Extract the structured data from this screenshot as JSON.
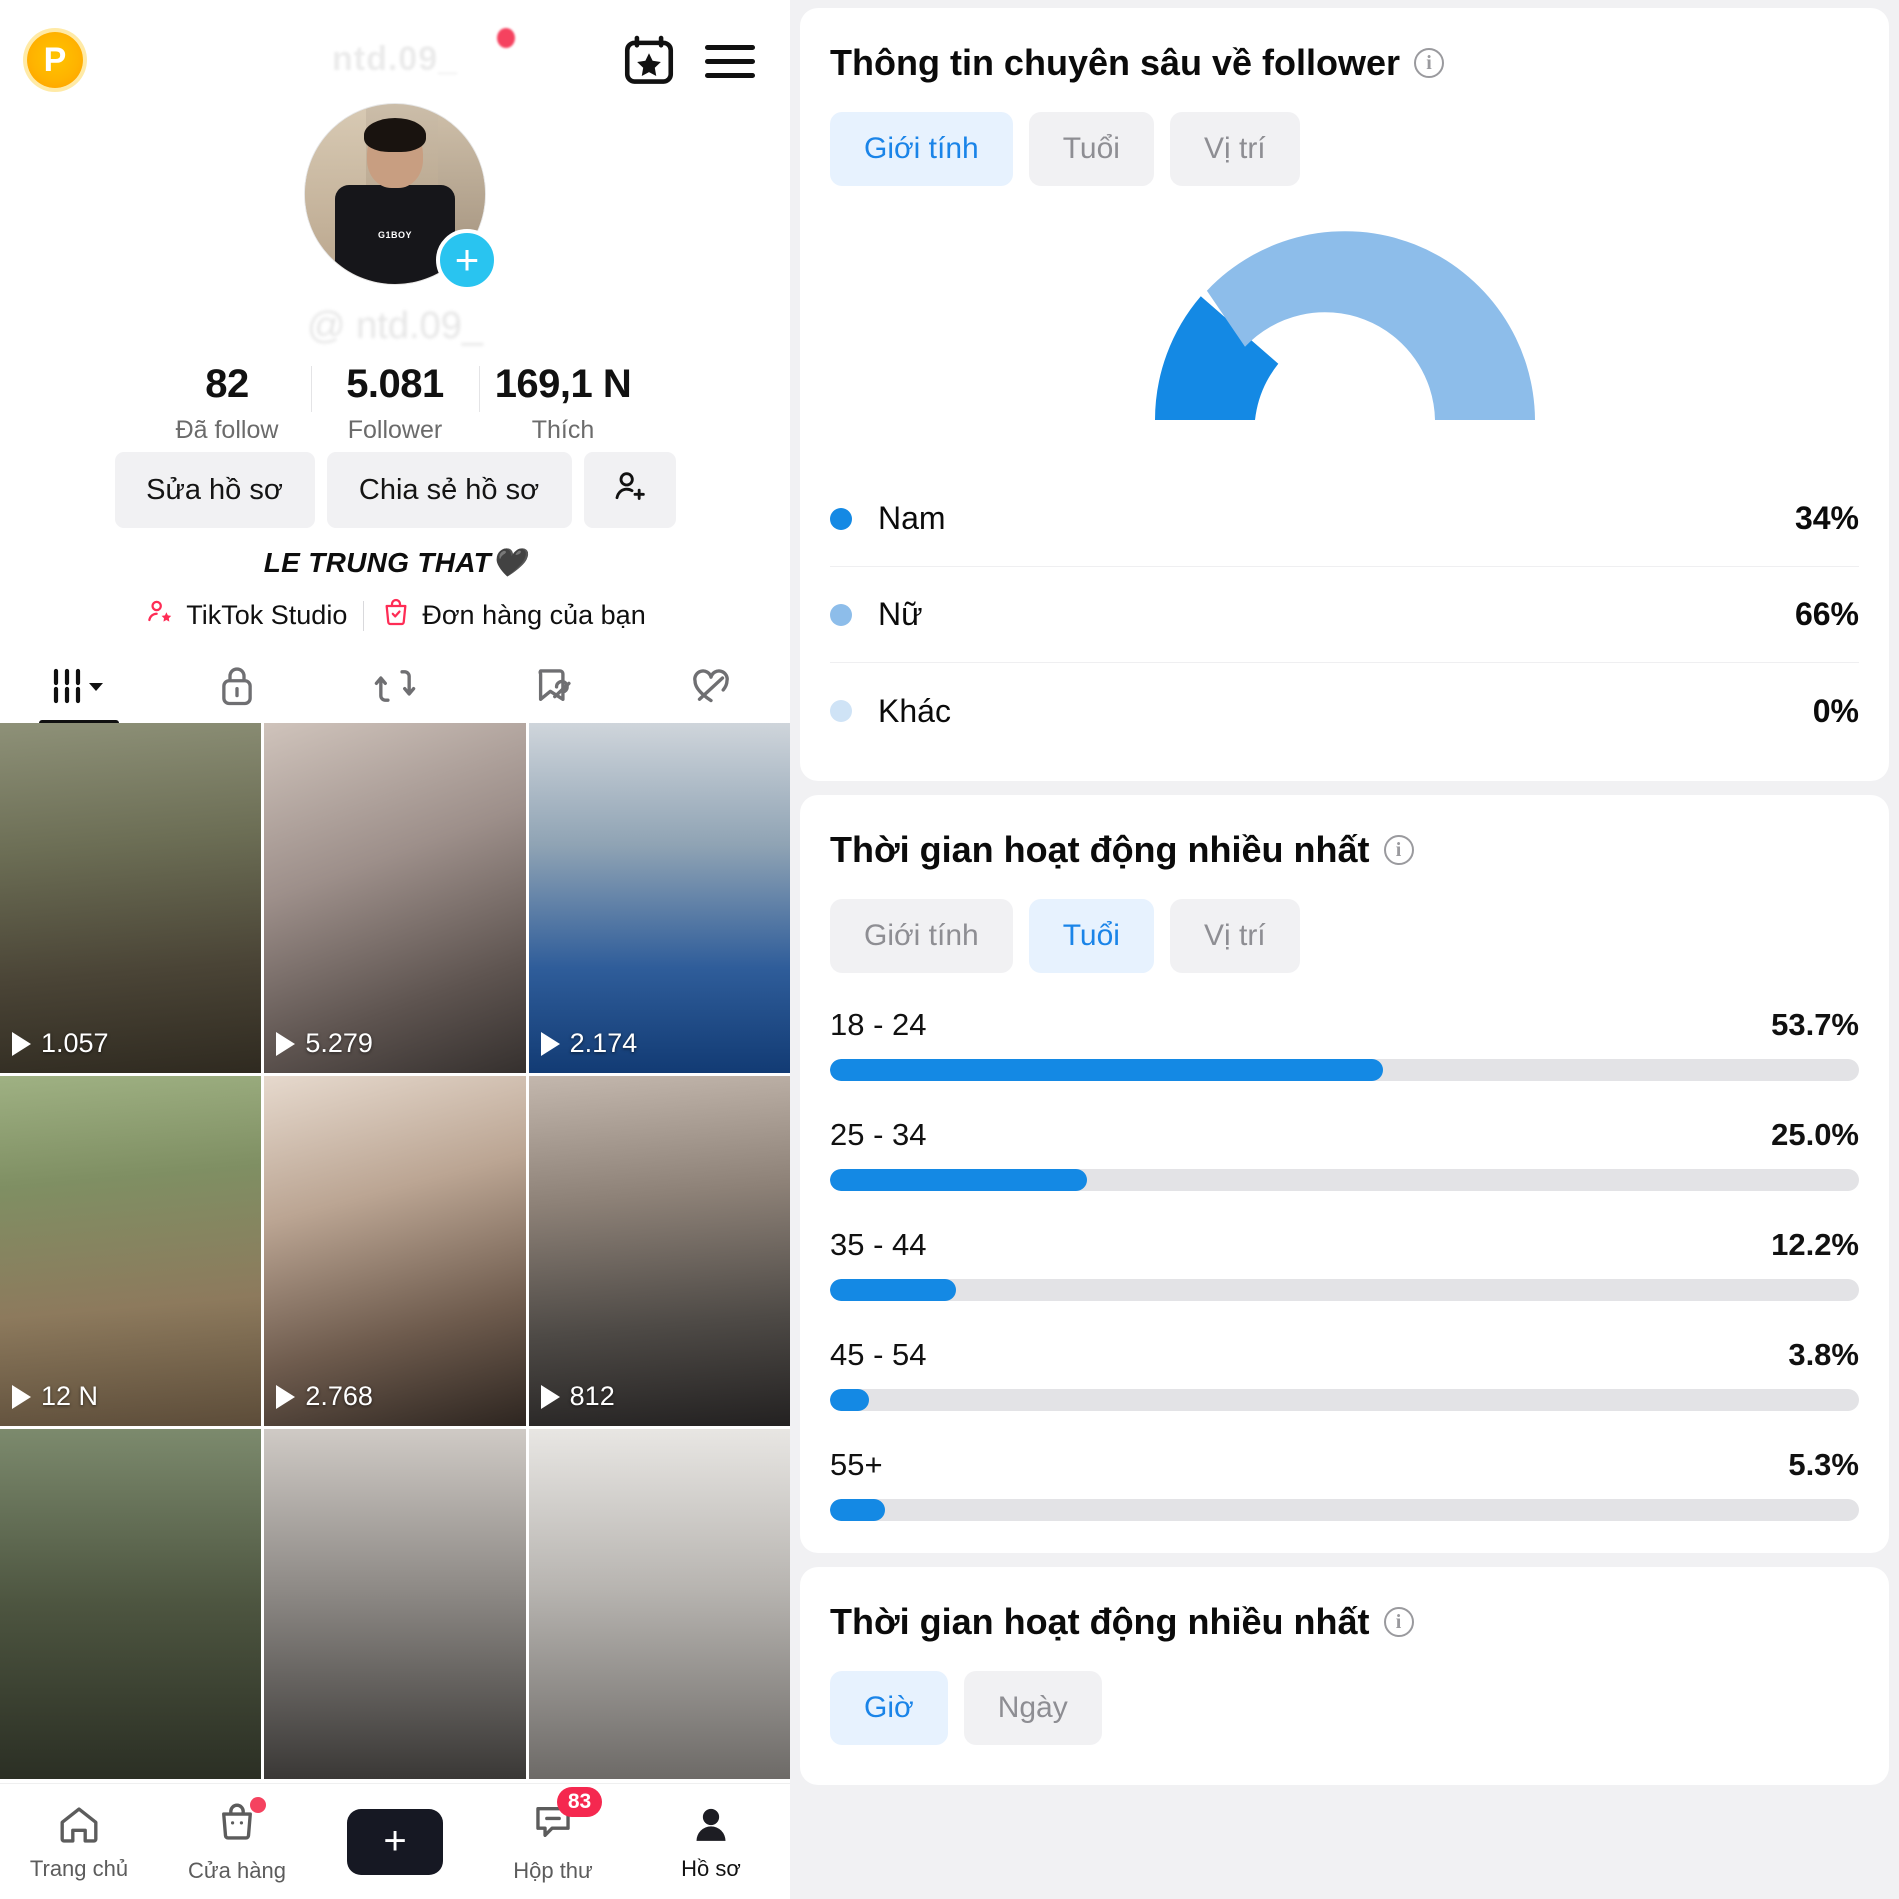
{
  "profile": {
    "coin_badge_label": "P",
    "ghost_handle_top": "ntd.09_",
    "handle_watermark": "@ ntd.09_",
    "stats": [
      {
        "number": "82",
        "label": "Đã follow"
      },
      {
        "number": "5.081",
        "label": "Follower"
      },
      {
        "number": "169,1 N",
        "label": "Thích"
      }
    ],
    "buttons": {
      "edit_profile": "Sửa hồ sơ",
      "share_profile": "Chia sẻ hồ sơ",
      "add_user_icon": "add-user-icon"
    },
    "bio": "LE TRUNG THAT🖤",
    "links": [
      {
        "icon": "tiktok-studio-icon",
        "label": "TikTok Studio"
      },
      {
        "icon": "shopping-bag-icon",
        "label": "Đơn hàng của bạn"
      }
    ],
    "tabs": [
      {
        "icon": "grid-posts-icon",
        "active": true
      },
      {
        "icon": "lock-private-icon",
        "active": false
      },
      {
        "icon": "repost-icon",
        "active": false
      },
      {
        "icon": "saved-hidden-icon",
        "active": false
      },
      {
        "icon": "liked-hidden-icon",
        "active": false
      }
    ],
    "videos": [
      {
        "views": "1.057",
        "thumb": "ph1"
      },
      {
        "views": "5.279",
        "thumb": "ph2"
      },
      {
        "views": "2.174",
        "thumb": "ph3"
      },
      {
        "views": "12 N",
        "thumb": "ph4"
      },
      {
        "views": "2.768",
        "thumb": "ph5"
      },
      {
        "views": "812",
        "thumb": "ph6"
      },
      {
        "views": "",
        "thumb": "ph7"
      },
      {
        "views": "",
        "thumb": "ph8"
      },
      {
        "views": "",
        "thumb": "ph9"
      }
    ],
    "bottom_nav": [
      {
        "icon": "home-icon",
        "label": "Trang chủ",
        "active": false,
        "dot": false,
        "badge": ""
      },
      {
        "icon": "shop-bag-icon",
        "label": "Cửa hàng",
        "active": false,
        "dot": true,
        "badge": ""
      },
      {
        "icon": "create-plus-icon",
        "label": "",
        "active": false,
        "dot": false,
        "badge": ""
      },
      {
        "icon": "inbox-icon",
        "label": "Hộp thư",
        "active": false,
        "dot": false,
        "badge": "83"
      },
      {
        "icon": "person-icon",
        "label": "Hồ sơ",
        "active": true,
        "dot": false,
        "badge": ""
      }
    ]
  },
  "analytics": {
    "follower_insights": {
      "title": "Thông tin chuyên sâu về follower",
      "info_icon": "info-icon",
      "tabs": [
        {
          "label": "Giới tính",
          "active": true
        },
        {
          "label": "Tuổi",
          "active": false
        },
        {
          "label": "Vị trí",
          "active": false
        }
      ]
    },
    "most_active_age": {
      "title": "Thời gian hoạt động nhiều nhất",
      "info_icon": "info-icon",
      "tabs": [
        {
          "label": "Giới tính",
          "active": false
        },
        {
          "label": "Tuổi",
          "active": true
        },
        {
          "label": "Vị trí",
          "active": false
        }
      ]
    },
    "most_active_time": {
      "title": "Thời gian hoạt động nhiều nhất",
      "info_icon": "info-icon",
      "tabs": [
        {
          "label": "Giờ",
          "active": true
        },
        {
          "label": "Ngày",
          "active": false
        }
      ]
    }
  },
  "colors": {
    "accent_blue": "#1489e4",
    "light_blue": "#8dbdea",
    "pale_blue": "#cfe3f6",
    "track_gray": "#e3e3e6",
    "tab_active_bg": "#e7f2fe",
    "tab_active_fg": "#1a84e8",
    "tiktok_pink": "#fe2c55",
    "tiktok_cyan": "#25f4ee"
  },
  "chart_data": [
    {
      "type": "pie",
      "title": "Thông tin chuyên sâu về follower — Giới tính",
      "legend_position": "below",
      "categories": [
        "Nam",
        "Nữ",
        "Khác"
      ],
      "values": [
        34,
        66,
        0
      ],
      "value_labels": [
        "34%",
        "66%",
        "0%"
      ],
      "colors": [
        "#1489e4",
        "#8dbdea",
        "#cfe3f6"
      ],
      "notes": "semicircular donut gauge, half-pie spanning 180 degrees"
    },
    {
      "type": "bar",
      "title": "Thời gian hoạt động nhiều nhất — Tuổi",
      "orientation": "horizontal",
      "categories": [
        "18 - 24",
        "25 - 34",
        "35 - 44",
        "45 - 54",
        "55+"
      ],
      "values": [
        53.7,
        25.0,
        12.2,
        3.8,
        5.3
      ],
      "value_labels": [
        "53.7%",
        "25.0%",
        "12.2%",
        "3.8%",
        "5.3%"
      ],
      "xlabel": "",
      "ylabel": "",
      "xlim": [
        0,
        100
      ],
      "grid": false,
      "bar_color": "#1489e4",
      "track_color": "#e3e3e6"
    }
  ]
}
